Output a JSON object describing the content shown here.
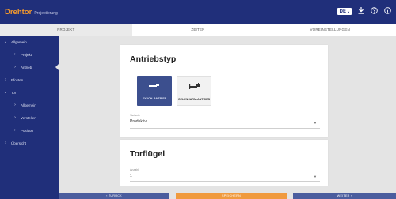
{
  "app": {
    "brand": "Drehtor",
    "subtitle": "Projektierung"
  },
  "header": {
    "language": "DE",
    "language_caret": "▾",
    "download_icon": "download-icon",
    "help_icon": "help-icon",
    "info_icon": "info-icon"
  },
  "tabs": [
    {
      "label": "PROJEKT",
      "active": true
    },
    {
      "label": "ZEITEN",
      "active": false
    },
    {
      "label": "VOREINSTELLUNGEN",
      "active": false
    }
  ],
  "sidebar": {
    "items": [
      {
        "label": "Allgemein",
        "chev": "⌄",
        "level": 0,
        "active": false
      },
      {
        "label": "Projekt",
        "chev": "›",
        "level": 1,
        "active": false
      },
      {
        "label": "Antrieb",
        "chev": "›",
        "level": 1,
        "active": true
      },
      {
        "label": "Pfosten",
        "chev": "›",
        "level": 0,
        "active": false
      },
      {
        "label": "Tor",
        "chev": "⌄",
        "level": 0,
        "active": false
      },
      {
        "label": "Allgemein",
        "chev": "›",
        "level": 1,
        "active": false
      },
      {
        "label": "Verstellen",
        "chev": "›",
        "level": 1,
        "active": false
      },
      {
        "label": "Position",
        "chev": "›",
        "level": 1,
        "active": false
      },
      {
        "label": "Übersicht",
        "chev": "›",
        "level": 0,
        "active": false
      }
    ]
  },
  "drive_card": {
    "title": "Antriebstyp",
    "options": [
      {
        "label": "SYNCH. ANTRIEB",
        "selected": true
      },
      {
        "label": "GELENKARM-ANTRIEB",
        "selected": false
      }
    ],
    "field": {
      "label": "Variante",
      "value": "Produktiv"
    }
  },
  "leaf_card": {
    "title": "Torflügel",
    "field": {
      "label": "Anzahl",
      "value": "1"
    }
  },
  "footer": {
    "back": "‹ ZURÜCK",
    "save": "SPEICHERN",
    "next": "WEITER ›"
  },
  "colors": {
    "primary": "#202f7a",
    "accent": "#f2982d",
    "background": "#e4e4e4"
  }
}
